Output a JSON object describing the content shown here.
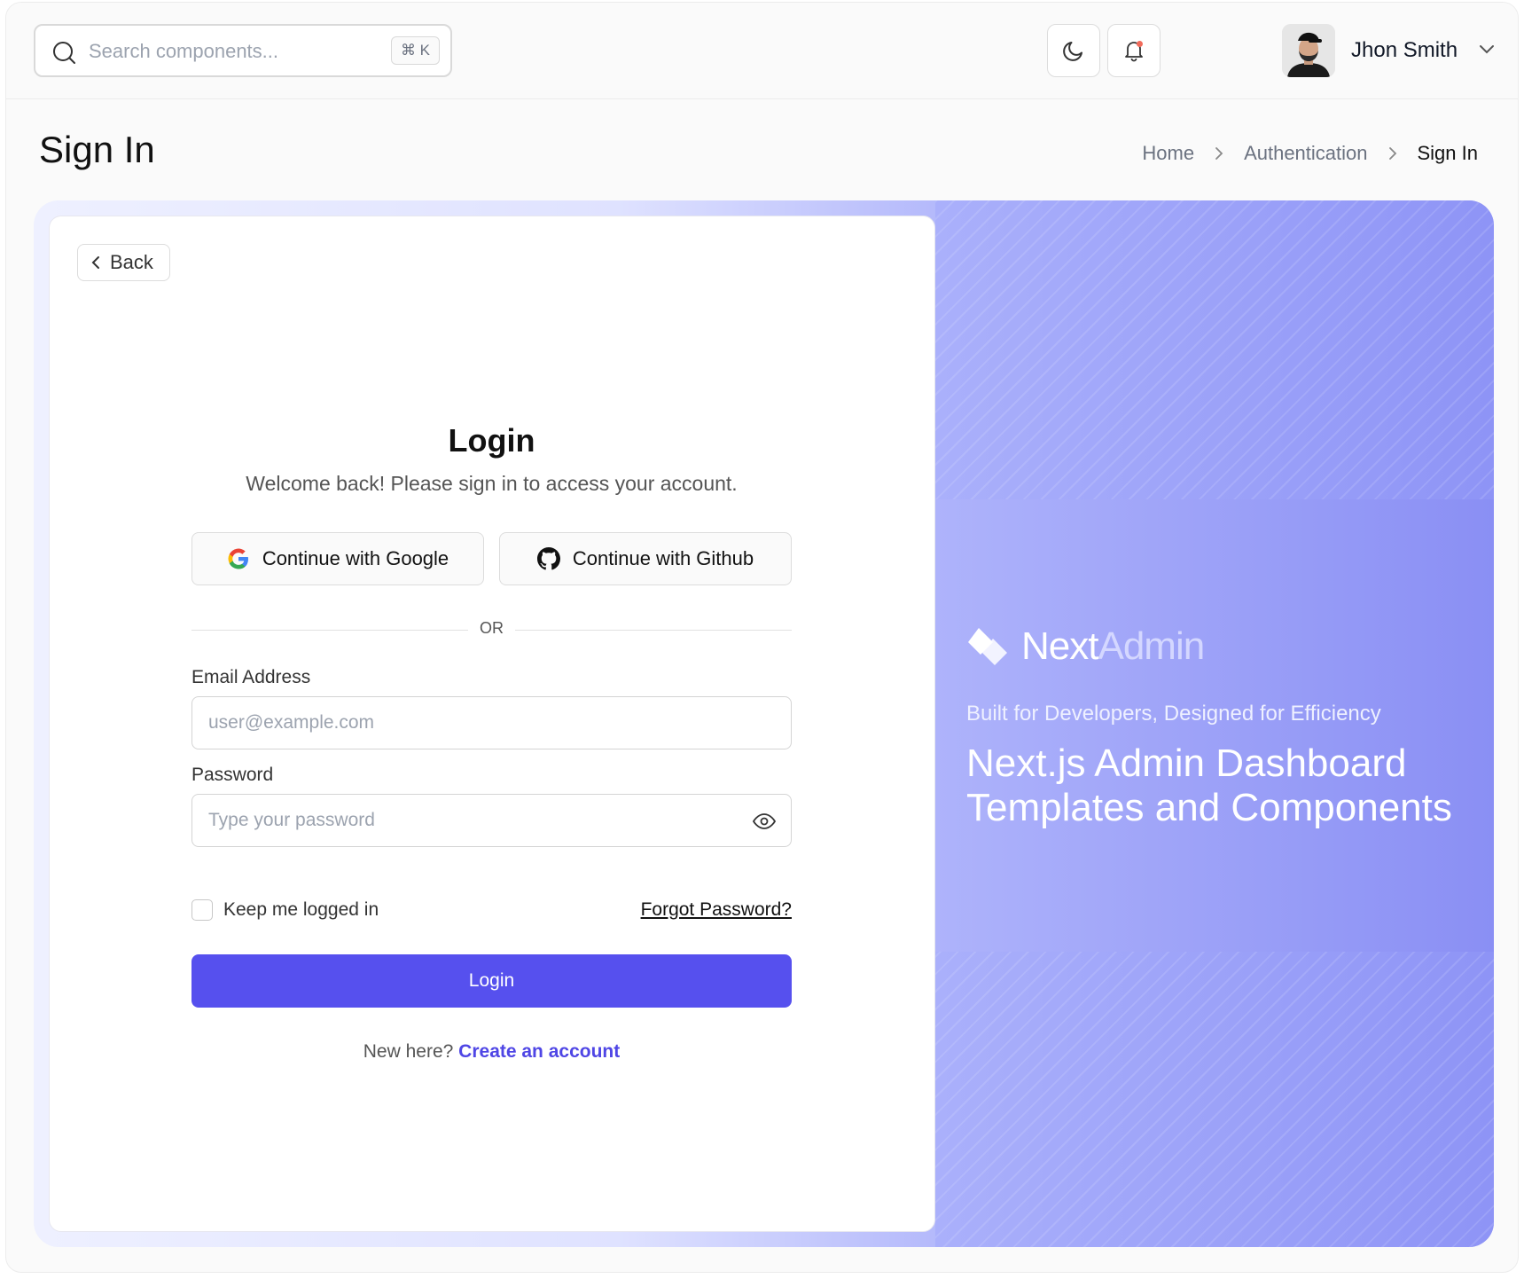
{
  "header": {
    "search_placeholder": "Search components...",
    "search_shortcut": "⌘ K",
    "user_name": "Jhon Smith"
  },
  "page": {
    "title": "Sign In",
    "breadcrumb": [
      "Home",
      "Authentication",
      "Sign In"
    ]
  },
  "form": {
    "back_label": "Back",
    "title": "Login",
    "subtitle": "Welcome back! Please sign in to access your account.",
    "google_label": "Continue with Google",
    "github_label": "Continue with Github",
    "divider": "OR",
    "email_label": "Email Address",
    "email_placeholder": "user@example.com",
    "password_label": "Password",
    "password_placeholder": "Type your password",
    "remember_label": "Keep me logged in",
    "forgot_label": "Forgot Password?",
    "submit_label": "Login",
    "signup_prompt": "New here?",
    "signup_link": "Create an account"
  },
  "hero": {
    "brand_primary": "Next",
    "brand_secondary": "Admin",
    "tagline": "Built for Developers, Designed for Efficiency",
    "headline": "Next.js Admin Dashboard Templates and Components"
  },
  "colors": {
    "accent": "#5650ee",
    "link": "#4f46e5"
  }
}
